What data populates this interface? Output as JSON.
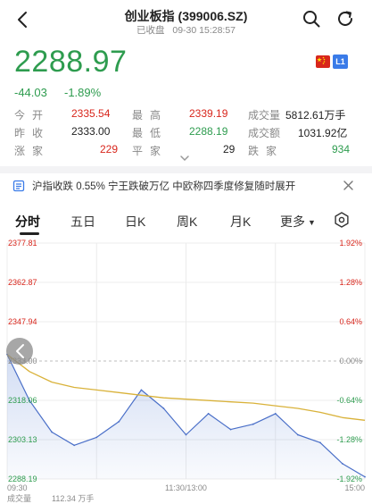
{
  "header": {
    "title": "创业板指 (399006.SZ)",
    "status": "已收盘",
    "datetime": "09-30 15:28:57"
  },
  "quote": {
    "price": "2288.97",
    "change": "-44.03",
    "change_pct": "-1.89%",
    "color": "#2e9c4f",
    "badge": "L1"
  },
  "stats": {
    "row1": {
      "l1": "今开",
      "v1": "2335.54",
      "l2": "最高",
      "v2": "2339.19",
      "l3": "成交量",
      "v3": "5812.61万手"
    },
    "row2": {
      "l1": "昨收",
      "v1": "2333.00",
      "l2": "最低",
      "v2": "2288.19",
      "l3": "成交额",
      "v3": "1031.92亿"
    },
    "row3": {
      "l1": "涨家",
      "v1": "229",
      "l2": "平家",
      "v2": "29",
      "l3": "跌家",
      "v3": "934"
    }
  },
  "news": {
    "text": "沪指收跌 0.55% 宁王跌破万亿 中欧称四季度修复随时展开"
  },
  "tabs": [
    {
      "label": "分时",
      "active": true
    },
    {
      "label": "五日",
      "active": false
    },
    {
      "label": "日K",
      "active": false
    },
    {
      "label": "周K",
      "active": false
    },
    {
      "label": "月K",
      "active": false
    },
    {
      "label": "更多",
      "active": false
    }
  ],
  "chart": {
    "y_left": [
      "2377.81",
      "2362.87",
      "2347.94",
      "2333.00",
      "2318.06",
      "2303.13",
      "2288.19"
    ],
    "y_right": [
      "1.92%",
      "1.28%",
      "0.64%",
      "0.00%",
      "-0.64%",
      "-1.28%",
      "-1.92%"
    ],
    "x_labels": [
      "09:30",
      "11:30/13:00",
      "15:00"
    ],
    "volume_label": "成交量",
    "volume_value": "112.34 万手",
    "marker_icon": "left-arrow-icon"
  },
  "chart_data": {
    "type": "line",
    "ylim": [
      2288.19,
      2377.81
    ],
    "prev_close": 2333.0,
    "x": [
      "09:30",
      "09:45",
      "10:00",
      "10:15",
      "10:30",
      "10:45",
      "11:00",
      "11:15",
      "11:30/13:00",
      "13:15",
      "13:30",
      "13:45",
      "14:00",
      "14:15",
      "14:30",
      "14:45",
      "15:00"
    ],
    "series": [
      {
        "values": [
          2335.5,
          2318,
          2306,
          2301,
          2304,
          2310,
          2322,
          2315,
          2305,
          2313,
          2307,
          2309,
          2313,
          2305,
          2302,
          2294,
          2289
        ]
      },
      {
        "values": [
          2335.5,
          2329,
          2325,
          2323,
          2322,
          2321,
          2320,
          2319,
          2318.5,
          2318,
          2317.5,
          2317,
          2316,
          2315,
          2313.5,
          2311.5,
          2310.5
        ]
      }
    ]
  }
}
